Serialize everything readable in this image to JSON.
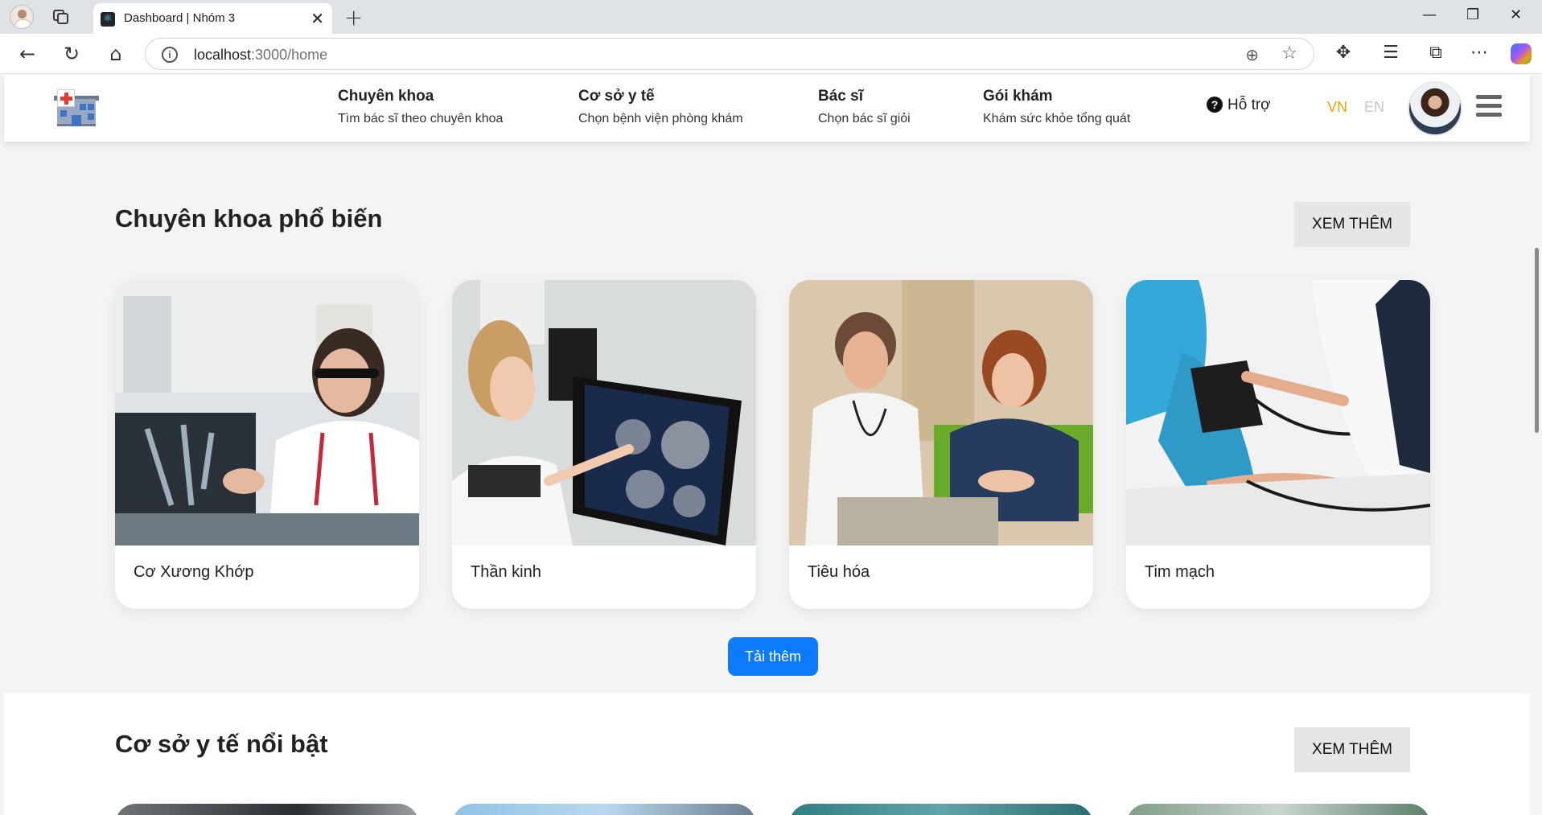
{
  "browser": {
    "tab_title": "Dashboard | Nhóm 3",
    "tab_close": "✕",
    "new_tab": "+",
    "window_controls": {
      "minimize": "—",
      "restore": "❐",
      "close": "✕"
    },
    "url_host": "localhost",
    "url_path": ":3000/home",
    "icons": [
      "back-icon",
      "refresh-icon",
      "home-icon",
      "info-icon",
      "zoom-icon",
      "star-icon",
      "extensions-icon",
      "favorites-icon",
      "screenshot-icon",
      "more-icon",
      "copilot-icon"
    ]
  },
  "header": {
    "menu": [
      {
        "title": "Chuyên khoa",
        "subtitle": "Tìm bác sĩ theo chuyên khoa"
      },
      {
        "title": "Cơ sở y tế",
        "subtitle": "Chọn bệnh viện phòng khám"
      },
      {
        "title": "Bác sĩ",
        "subtitle": "Chọn bác sĩ giỏi"
      },
      {
        "title": "Gói khám",
        "subtitle": "Khám sức khỏe tổng quát"
      }
    ],
    "support_label": "Hỗ trợ",
    "lang_vn": "VN",
    "lang_en": "EN",
    "active_lang_color": "#f0a500"
  },
  "specialties": {
    "title": "Chuyên khoa phổ biến",
    "more_label": "XEM THÊM",
    "items": [
      {
        "name": "Cơ Xương Khớp"
      },
      {
        "name": "Thần kinh"
      },
      {
        "name": "Tiêu hóa"
      },
      {
        "name": "Tim mạch"
      }
    ],
    "load_more_label": "Tải thêm",
    "load_more_color": "#0d7bff"
  },
  "facilities": {
    "title": "Cơ sở y tế nổi bật",
    "more_label": "XEM THÊM"
  }
}
